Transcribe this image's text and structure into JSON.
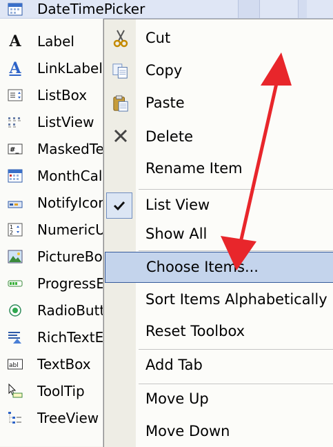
{
  "toolbox": {
    "header": {
      "label": "DateTimePicker",
      "icon": "datetimepicker-icon"
    },
    "items": [
      {
        "label": "Label",
        "icon": "label-icon"
      },
      {
        "label": "LinkLabel",
        "icon": "linklabel-icon"
      },
      {
        "label": "ListBox",
        "icon": "listbox-icon"
      },
      {
        "label": "ListView",
        "icon": "listview-icon"
      },
      {
        "label": "MaskedTe",
        "icon": "maskedtextbox-icon"
      },
      {
        "label": "MonthCal",
        "icon": "monthcalendar-icon"
      },
      {
        "label": "NotifyIcor",
        "icon": "notifyicon-icon"
      },
      {
        "label": "NumericU",
        "icon": "numericupdown-icon"
      },
      {
        "label": "PictureBo",
        "icon": "picturebox-icon"
      },
      {
        "label": "ProgressE",
        "icon": "progressbar-icon"
      },
      {
        "label": "RadioButt",
        "icon": "radiobutton-icon"
      },
      {
        "label": "RichTextE",
        "icon": "richtextbox-icon"
      },
      {
        "label": "TextBox",
        "icon": "textbox-icon"
      },
      {
        "label": "ToolTip",
        "icon": "tooltip-icon"
      },
      {
        "label": "TreeView",
        "icon": "treeview-icon"
      }
    ]
  },
  "context_menu": {
    "items": [
      {
        "label": "Cut",
        "icon": "cut-icon"
      },
      {
        "label": "Copy",
        "icon": "copy-icon"
      },
      {
        "label": "Paste",
        "icon": "paste-icon"
      },
      {
        "label": "Delete",
        "icon": "delete-icon"
      },
      {
        "label": "Rename Item",
        "icon": ""
      },
      {
        "label": "List View",
        "icon": "checkmark-icon",
        "checked": true
      },
      {
        "label": "Show All",
        "icon": ""
      },
      {
        "label": "Choose Items...",
        "icon": "",
        "highlighted": true
      },
      {
        "label": "Sort Items Alphabetically",
        "icon": ""
      },
      {
        "label": "Reset Toolbox",
        "icon": ""
      },
      {
        "label": "Add Tab",
        "icon": ""
      },
      {
        "label": "Move Up",
        "icon": ""
      },
      {
        "label": "Move Down",
        "icon": ""
      }
    ]
  },
  "colors": {
    "highlight_fill": "#c4d4ec",
    "highlight_border": "#34599a",
    "arrow": "#e8262b"
  }
}
